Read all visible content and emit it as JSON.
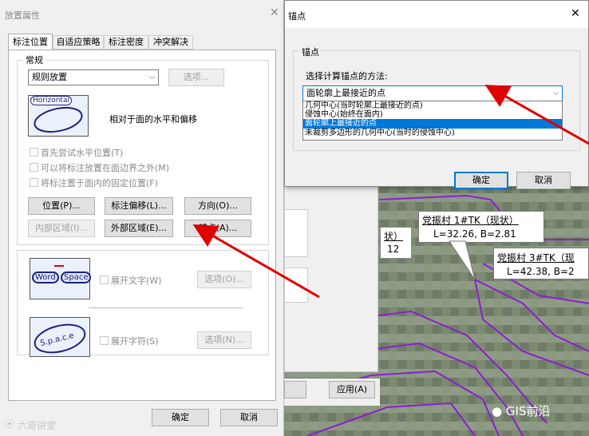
{
  "left_dialog": {
    "title": "放置属性",
    "tabs": [
      "标注位置",
      "自适应策略",
      "标注密度",
      "冲突解决"
    ],
    "group_general": "常规",
    "placement_select": "规则放置",
    "options_button": "选项...",
    "preview_label": "Horizontal",
    "preview_desc": "相对于面的水平和偏移",
    "checkboxes": [
      "首先尝试水平位置(T)",
      "可以将标注放置在面边界之外(M)",
      "将标注置于面内的固定位置(F)"
    ],
    "buttons_row1": [
      "位置(P)...",
      "标注偏移(L)...",
      "方向(O)..."
    ],
    "buttons_row2": [
      "内部区域(I)...",
      "外部区域(E)...",
      "锚点(A)..."
    ],
    "word_label": "Word",
    "space_label": "Space",
    "spread_text": "展开文字(W)",
    "spread_text_options": "选项(O)...",
    "spread_char": "展开字符(S)",
    "spread_char_options": "选项(N)...",
    "ok": "确定",
    "cancel": "取消",
    "watermark": "六哥讲堂",
    "space_text": "S.p.a.c.e"
  },
  "anchor_dialog": {
    "title": "锚点",
    "group": "锚点",
    "prompt": "选择计算锚点的方法:",
    "selected": "面轮廓上最接近的点",
    "options": [
      "几何中心(当时轮廓上最接近的点)",
      "侵蚀中心(始终在面内)",
      "面轮廓上最接近的点",
      "未裁剪多边形的几何中心(当时的侵蚀中心)"
    ],
    "ok": "确定",
    "cancel": "取消"
  },
  "map": {
    "apply": "应用(A)",
    "label1_title": "党振村 1#TK（现状）",
    "label1_value": "L=32.26, B=2.81",
    "label2_title": "党振村 3#TK（现",
    "label2_value": "L=42.38, B=2",
    "partial_label1": "状）",
    "partial_label2": "12",
    "brand": "GIS前沿"
  },
  "colors": {
    "accent": "#0078d7",
    "arrow": "#e00000",
    "polygon": "#8a1fd0",
    "map_bg": "#7a8f74"
  }
}
